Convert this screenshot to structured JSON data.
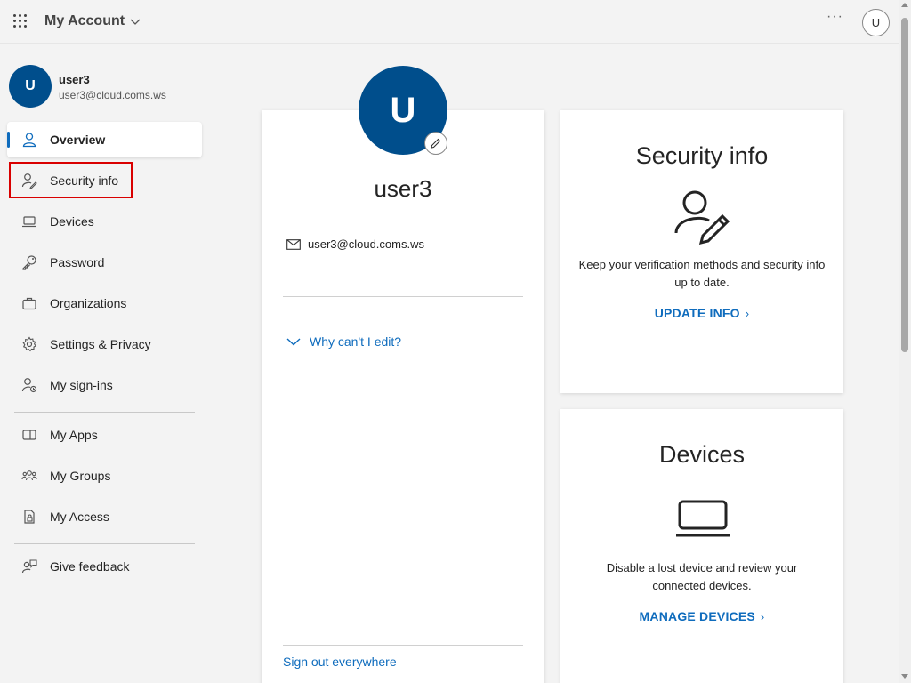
{
  "header": {
    "app_title": "My Account",
    "more_label": "···",
    "avatar_initial": "U"
  },
  "user": {
    "initial": "U",
    "name": "user3",
    "email": "user3@cloud.coms.ws"
  },
  "nav": {
    "items": [
      {
        "label": "Overview",
        "icon": "person-icon",
        "active": true
      },
      {
        "label": "Security info",
        "icon": "person-key-icon"
      },
      {
        "label": "Devices",
        "icon": "laptop-icon"
      },
      {
        "label": "Password",
        "icon": "key-icon"
      },
      {
        "label": "Organizations",
        "icon": "briefcase-icon"
      },
      {
        "label": "Settings & Privacy",
        "icon": "gear-icon"
      },
      {
        "label": "My sign-ins",
        "icon": "sign-ins-icon"
      },
      {
        "label": "My Apps",
        "icon": "apps-icon"
      },
      {
        "label": "My Groups",
        "icon": "people-icon"
      },
      {
        "label": "My Access",
        "icon": "lock-doc-icon"
      },
      {
        "label": "Give feedback",
        "icon": "feedback-icon"
      }
    ]
  },
  "profile_card": {
    "initial": "U",
    "name": "user3",
    "email": "user3@cloud.coms.ws",
    "why_cant_edit": "Why can't I edit?",
    "sign_out": "Sign out everywhere"
  },
  "security_card": {
    "title": "Security info",
    "description": "Keep your verification methods and security info up to date.",
    "link": "UPDATE INFO"
  },
  "devices_card": {
    "title": "Devices",
    "description": "Disable a lost device and review your connected devices.",
    "link": "MANAGE DEVICES"
  },
  "colors": {
    "accent": "#0f6cbd",
    "avatar": "#004e8c",
    "highlight": "#d90000"
  }
}
